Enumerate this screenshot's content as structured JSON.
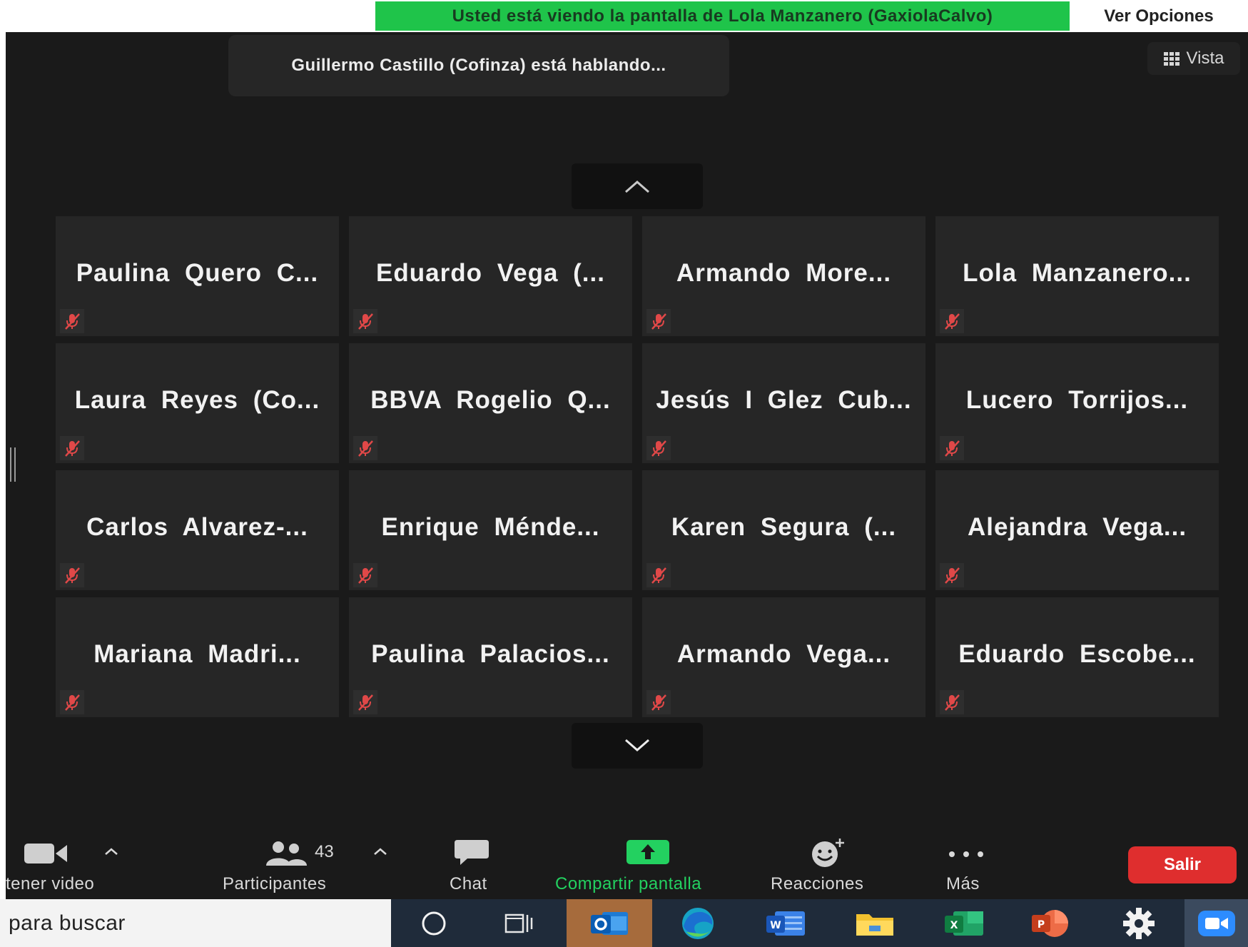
{
  "banner": {
    "sharing_text": "Usted está viendo la pantalla de Lola Manzanero (GaxiolaCalvo)",
    "view_options": "Ver Opciones"
  },
  "speaker": {
    "text": "Guillermo Castillo (Cofinza) está hablando..."
  },
  "view_button": {
    "label": "Vista"
  },
  "participants_grid": [
    {
      "name": "Paulina  Quero  C...",
      "muted": true
    },
    {
      "name": "Eduardo  Vega  (...",
      "muted": true
    },
    {
      "name": "Armando  More...",
      "muted": true
    },
    {
      "name": "Lola  Manzanero...",
      "muted": true
    },
    {
      "name": "Laura  Reyes  (Co...",
      "muted": true
    },
    {
      "name": "BBVA  Rogelio  Q...",
      "muted": true
    },
    {
      "name": "Jesús  I  Glez  Cub...",
      "muted": true
    },
    {
      "name": "Lucero  Torrijos...",
      "muted": true
    },
    {
      "name": "Carlos  Alvarez-...",
      "muted": true
    },
    {
      "name": "Enrique  Ménde...",
      "muted": true
    },
    {
      "name": "Karen  Segura  (...",
      "muted": true
    },
    {
      "name": "Alejandra  Vega...",
      "muted": true
    },
    {
      "name": "Mariana  Madri...",
      "muted": true
    },
    {
      "name": "Paulina  Palacios...",
      "muted": true
    },
    {
      "name": "Armando  Vega...",
      "muted": true
    },
    {
      "name": "Eduardo  Escobe...",
      "muted": true
    }
  ],
  "toolbar": {
    "video_label": "tener video",
    "participants_label": "Participantes",
    "participants_count": "43",
    "chat_label": "Chat",
    "share_label": "Compartir pantalla",
    "reactions_label": "Reacciones",
    "more_label": "Más",
    "leave_label": "Salir"
  },
  "taskbar": {
    "search_text": "para buscar"
  },
  "colors": {
    "share_green": "#1fc44a",
    "meeting_bg": "#1a1a1a",
    "tile_bg": "#262626",
    "leave_red": "#df2e2e",
    "mute_red": "#e04848",
    "toolbar_green": "#23d160"
  }
}
